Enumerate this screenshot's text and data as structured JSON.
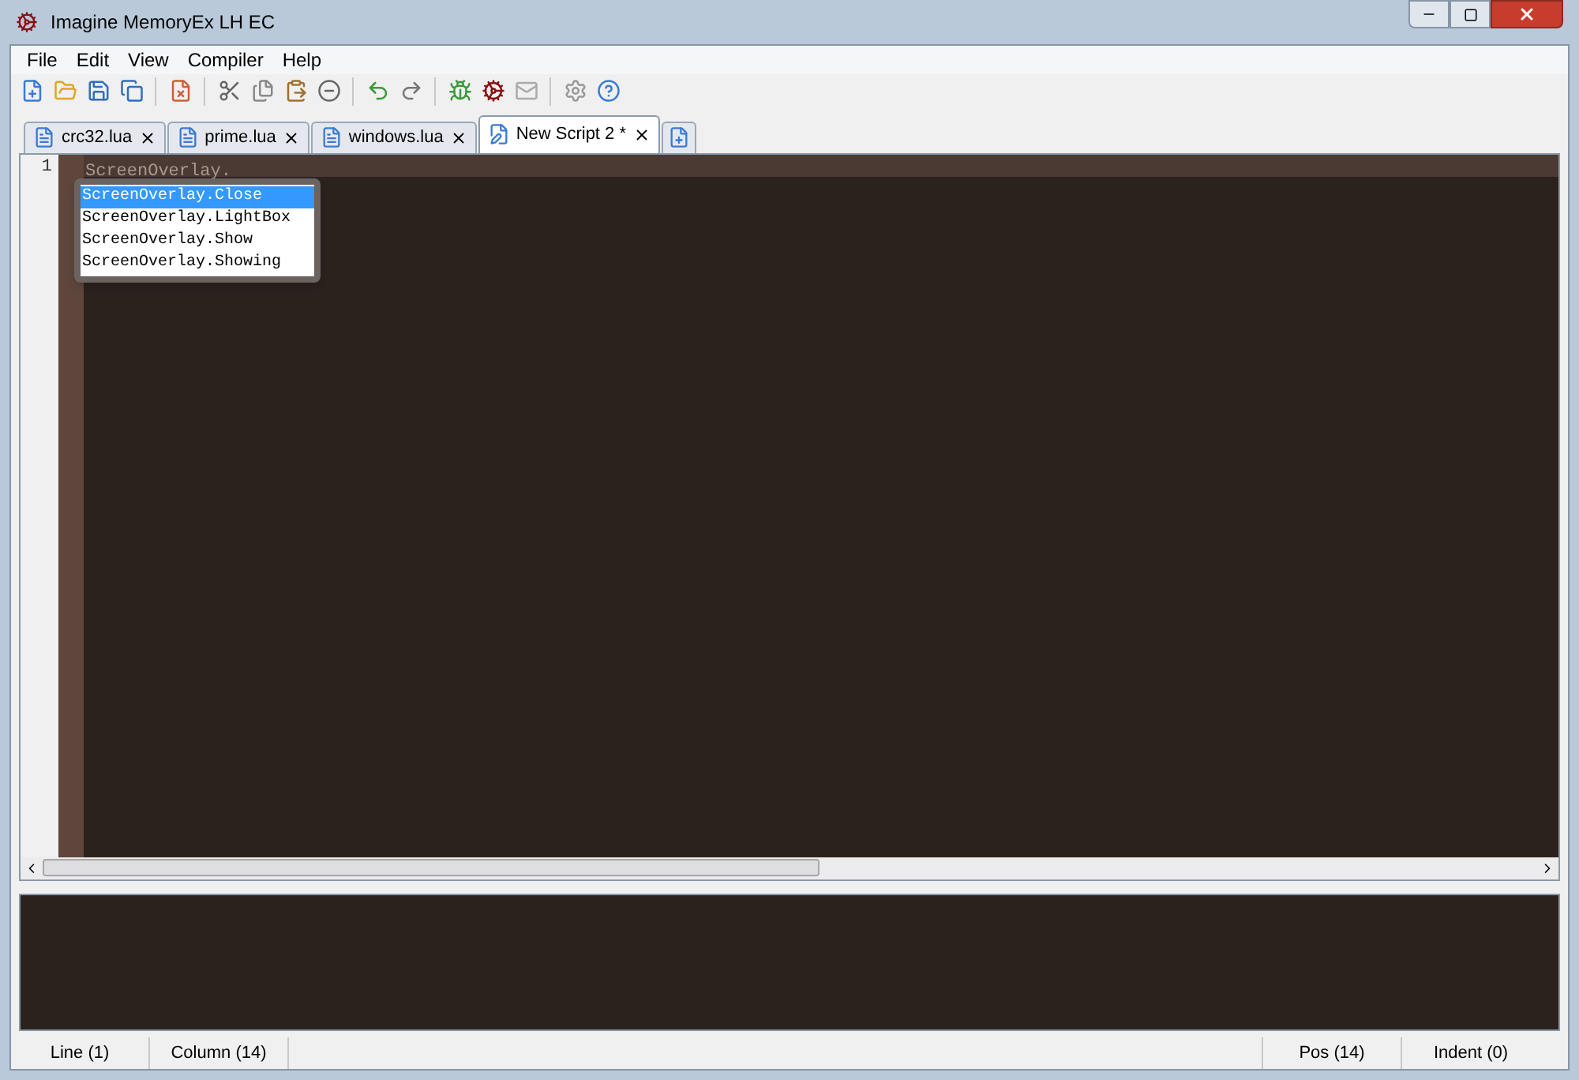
{
  "window": {
    "title": "Imagine MemoryEx LH EC"
  },
  "menu": [
    "File",
    "Edit",
    "View",
    "Compiler",
    "Help"
  ],
  "tabs": [
    {
      "label": "crc32.lua",
      "selected": false,
      "kind": "file"
    },
    {
      "label": "prime.lua",
      "selected": false,
      "kind": "file"
    },
    {
      "label": "windows.lua",
      "selected": false,
      "kind": "file"
    },
    {
      "label": "New Script 2 *",
      "selected": true,
      "kind": "edited"
    }
  ],
  "editor": {
    "line_numbers": [
      "1"
    ],
    "lines": [
      "ScreenOverlay."
    ],
    "autocomplete": [
      {
        "label": "ScreenOverlay.Close",
        "selected": true
      },
      {
        "label": "ScreenOverlay.LightBox",
        "selected": false
      },
      {
        "label": "ScreenOverlay.Show",
        "selected": false
      },
      {
        "label": "ScreenOverlay.Showing",
        "selected": false
      }
    ]
  },
  "status_bar": {
    "left": [
      "Line (1)",
      "Column (14)"
    ],
    "right": [
      "Pos (14)",
      "Indent (0)"
    ]
  }
}
